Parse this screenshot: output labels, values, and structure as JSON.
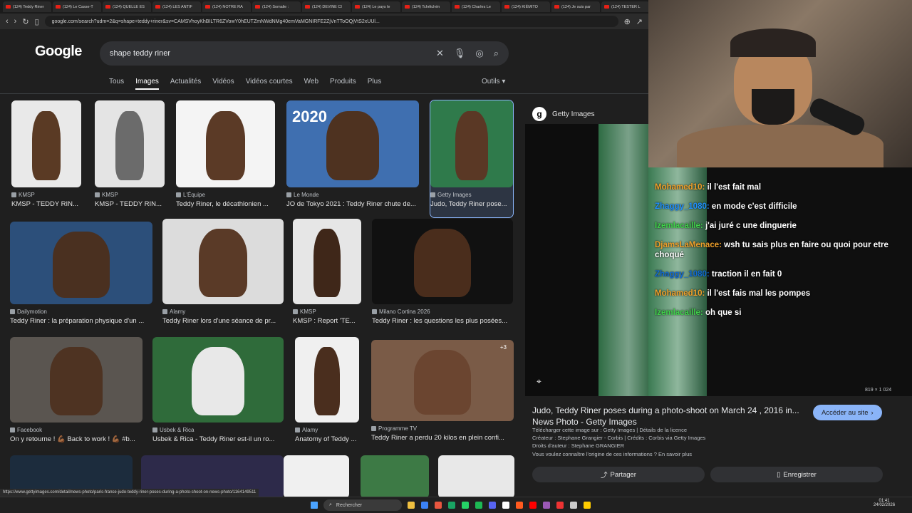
{
  "browser": {
    "tabs": [
      "(124) Teddy Riner",
      "(124) Le Casse-T",
      "(124) QUELLE ES",
      "(124) LES ANTIF",
      "(124) NOTRE RA",
      "(124) Somalie :",
      "(124) DEVINE CI",
      "(124) Le pays le",
      "(124) Tchétchén",
      "(124) Charles Le",
      "(124) KIÉMITO",
      "(124) Je suis par",
      "(124) TESTER L"
    ],
    "url": "google.com/search?udm=2&q=shape+teddy+riner&sv=CAMSVhoyKhBILTR6ZVowY0hEUTZmNWdNMg40emVaMGNIRFE2ZjVnTToOQjVtS2xUUl...",
    "status_url": "https://www.gettyimages.com/detail/news-photo/paris-france-judo-teddy-riner-poses-during-a-photo-shoot-on-news-photo/1164149511"
  },
  "google": {
    "logo": "Google",
    "query": "shape teddy riner",
    "tabs": [
      "Tous",
      "Images",
      "Actualités",
      "Vidéos",
      "Vidéos courtes",
      "Web",
      "Produits",
      "Plus"
    ],
    "tools": "Outils"
  },
  "results": [
    {
      "source": "KMSP",
      "title": "KMSP - TEDDY RIN..."
    },
    {
      "source": "KMSP",
      "title": "KMSP - TEDDY RIN..."
    },
    {
      "source": "L'Équipe",
      "title": "Teddy Riner, le décathlonien ..."
    },
    {
      "source": "Le Monde",
      "title": "JO de Tokyo 2021 : Teddy Riner chute de..."
    },
    {
      "source": "Getty Images",
      "title": "Judo, Teddy Riner pose..."
    },
    {
      "source": "Dailymotion",
      "title": "Teddy Riner : la préparation physique d'un ..."
    },
    {
      "source": "Alamy",
      "title": "Teddy Riner lors d'une séance de pr..."
    },
    {
      "source": "KMSP",
      "title": "KMSP : Report 'TE..."
    },
    {
      "source": "Milano Cortina 2026",
      "title": "Teddy Riner : les questions les plus posées..."
    },
    {
      "source": "Facebook",
      "title": "On y retourne ! 💪🏾 Back to work ! 💪🏾 #b..."
    },
    {
      "source": "Usbek & Rica",
      "title": "Usbek & Rica - Teddy Riner est-il un ro..."
    },
    {
      "source": "Alamy",
      "title": "Anatomy of Teddy ..."
    },
    {
      "source": "Programme TV",
      "title": "Teddy Riner a perdu 20 kilos en plein confi..."
    }
  ],
  "thumb_labels": {
    "year": "2020",
    "plus3": "+3"
  },
  "panel": {
    "source": "Getty Images",
    "dims": "819 × 1 024",
    "title": "Judo, Teddy Riner poses during a photo-shoot on March 24 , 2016 in...",
    "subtitle": "News Photo - Getty Images",
    "visit": "Accéder au site",
    "line1": "Télécharger cette image sur : Getty Images | Détails de la licence",
    "line2": "Créateur : Stephane Grangier - Corbis | Crédits : Corbis via Getty Images",
    "line3": "Droits d'auteur : Stephane GRANGIER",
    "line4": "Vous voulez connaître l'origine de ces informations ? En savoir plus",
    "share": "Partager",
    "save": "Enregistrer"
  },
  "chat": [
    {
      "user": "Mohamed10:",
      "text": " il l'est fait mal",
      "color": "u1"
    },
    {
      "user": "Zhaggy_1080:",
      "text": " en mode c'est difficile",
      "color": "u2"
    },
    {
      "user": "Izemlacaille:",
      "text": " j'ai juré c une dinguerie",
      "color": "u3"
    },
    {
      "user": "DjamsLaMenace:",
      "text": " wsh tu sais plus en faire ou quoi pour etre choqué",
      "color": "u1"
    },
    {
      "user": "Zhaggy_1080:",
      "text": " traction il en fait 0",
      "color": "u4"
    },
    {
      "user": "Mohamed10:",
      "text": " il l'est fais mal les pompes",
      "color": "u1"
    },
    {
      "user": "Izemlacaille:",
      "text": " oh que si",
      "color": "u3"
    }
  ],
  "taskbar": {
    "search": "Rechercher",
    "time": "01:41",
    "date": "24/02/2026"
  }
}
